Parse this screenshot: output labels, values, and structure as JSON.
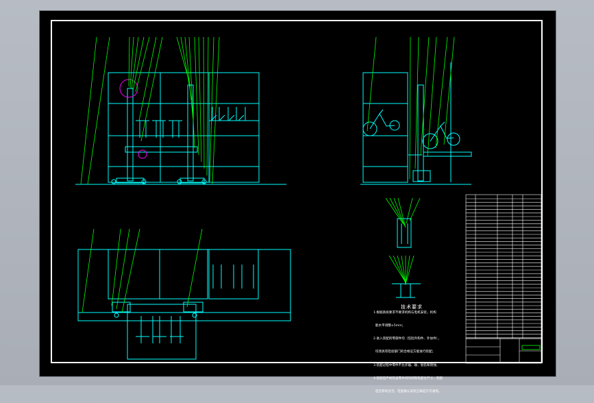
{
  "drawing": {
    "notes_title": "技术要求",
    "notes": [
      "1.根据系统要求不要求机构与电机安装，机构",
      "  能水平调整±5mm；",
      "2.进入装配的零部件均（包括外购件、外协件），",
      "  均须具有检验部门的合格证方能进行装配；",
      "3.装配过程中零件不允许磕、碰、划伤和锈蚀；",
      "4.装配后严格检查零件间的间隙及配合尺寸，装配",
      "  后应转动灵活，检查确认安装正确后方可通电。"
    ],
    "title_block_caption": "",
    "colors": {
      "background": "#000000",
      "primary_lines": "#00ffff",
      "leader_lines": "#00ff00",
      "highlight": "#ff00ff",
      "border": "#ffffff"
    }
  }
}
